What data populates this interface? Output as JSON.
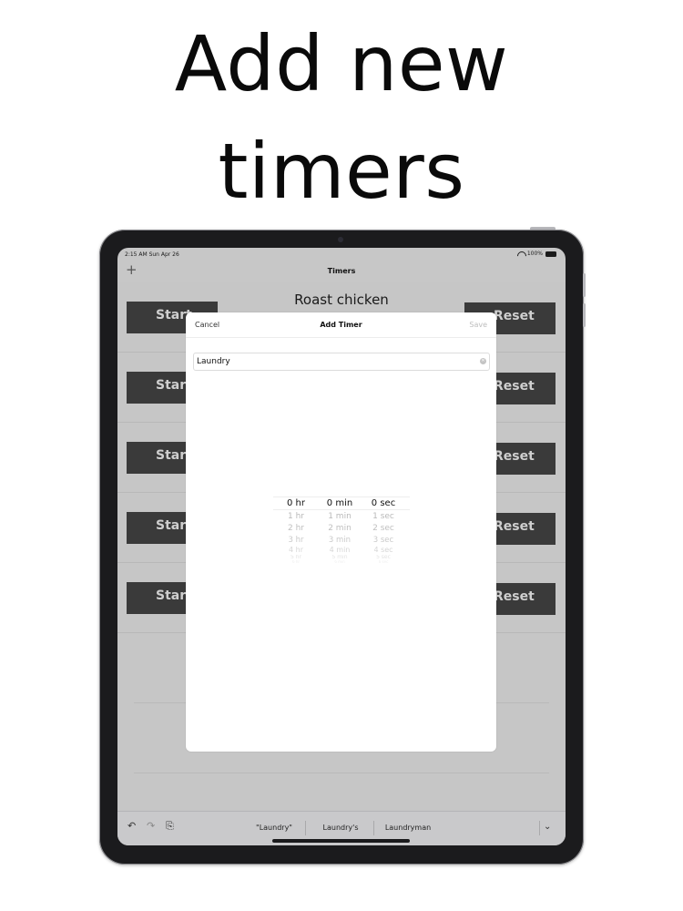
{
  "headline": {
    "line1": "Add new",
    "line2": "timers"
  },
  "status_bar": {
    "time": "2:15 AM  Sun Apr 26",
    "battery": "100%"
  },
  "nav": {
    "title": "Timers",
    "add": "+"
  },
  "timers": [
    {
      "name": "Roast chicken",
      "start": "Start",
      "reset": "Reset"
    },
    {
      "name": "",
      "start": "Start",
      "reset": "Reset"
    },
    {
      "name": "",
      "start": "Start",
      "reset": "Reset"
    },
    {
      "name": "",
      "start": "Start",
      "reset": "Reset"
    },
    {
      "name": "",
      "start": "Start",
      "reset": "Reset"
    }
  ],
  "modal": {
    "cancel": "Cancel",
    "title": "Add Timer",
    "save": "Save",
    "name_value": "Laundry",
    "picker": {
      "hours": [
        "0 hr",
        "1 hr",
        "2 hr",
        "3 hr",
        "4 hr",
        "5 hr",
        "6 hr"
      ],
      "minutes": [
        "0 min",
        "1 min",
        "2 min",
        "3 min",
        "4 min",
        "5 min",
        "6 min"
      ],
      "seconds": [
        "0 sec",
        "1 sec",
        "2 sec",
        "3 sec",
        "4 sec",
        "5 sec",
        "6 sec"
      ]
    }
  },
  "keyboard_bar": {
    "suggestions": [
      "\"Laundry\"",
      "Laundry's",
      "Laundryman"
    ]
  },
  "icons": {
    "undo": "undo-icon",
    "redo": "redo-icon",
    "paste": "paste-icon",
    "collapse": "chevron-down-icon",
    "clear": "clear-icon"
  }
}
